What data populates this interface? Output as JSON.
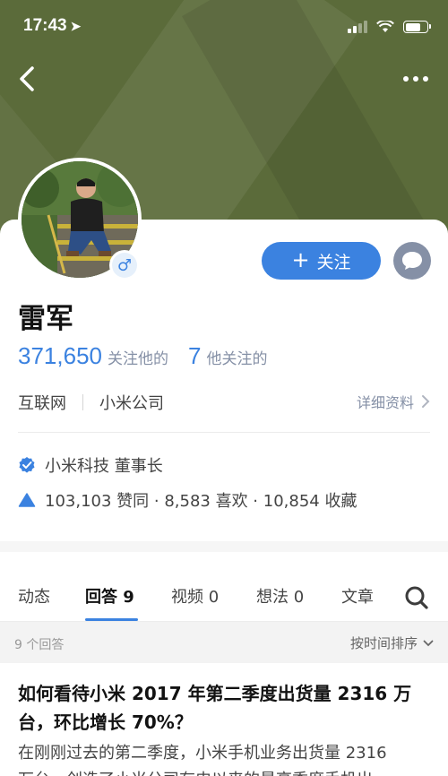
{
  "status_bar": {
    "time": "17:43",
    "location_icon": "location-arrow-icon"
  },
  "nav": {
    "back_icon": "chevron-left-icon",
    "more_icon": "more-dots-icon"
  },
  "profile": {
    "name": "雷军",
    "gender_symbol": "♂",
    "follow_label": "关注",
    "followers_count": "371,650",
    "followers_label": "关注他的",
    "following_count": "7",
    "following_label": "他关注的",
    "tags": [
      "互联网",
      "小米公司"
    ],
    "detail_link": "详细资料",
    "verified_title": "小米科技 董事长",
    "achievements": "103,103 赞同 · 8,583 喜欢 · 10,854 收藏"
  },
  "tabs": [
    {
      "label": "动态"
    },
    {
      "label": "回答 9"
    },
    {
      "label": "视频 0"
    },
    {
      "label": "想法 0"
    },
    {
      "label": "文章"
    }
  ],
  "list_header": {
    "count_text": "9 个回答",
    "sort_label": "按时间排序"
  },
  "answer": {
    "title": "如何看待小米 2017 年第二季度出货量 2316 万台，环比增长 70%？",
    "excerpt_line1": "在刚刚过去的第二季度，小米手机业务出货量 2316",
    "excerpt_line2": "万台，创造了小米公司有史以来的最高季度手机出"
  },
  "colors": {
    "accent": "#3b82e0",
    "header_bg": "#5b6b3a",
    "muted": "#8590a6"
  }
}
